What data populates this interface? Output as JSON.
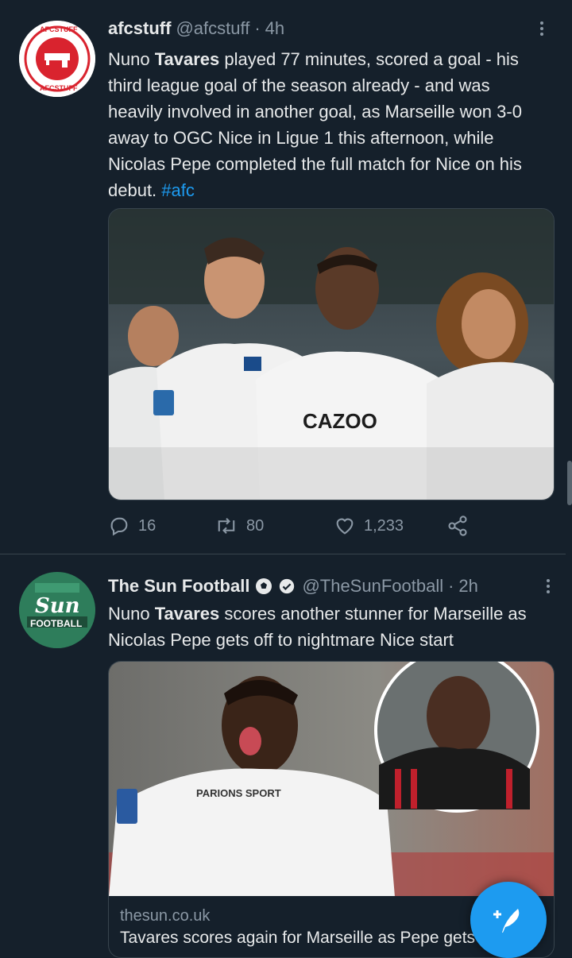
{
  "tweets": [
    {
      "name": "afcstuff",
      "handle": "@afcstuff",
      "separator": "·",
      "time": "4h",
      "avatar_text_top": "AFCSTUFF",
      "avatar_text_bottom": "AFCSTUFF",
      "text_parts": {
        "p1": "Nuno ",
        "bold": "Tavares",
        "p2": " played 77 minutes, scored a goal - his third league goal of the season already - and was heavily involved in another goal, as Marseille won 3-0 away to OGC Nice in Ligue 1 this afternoon, while Nicolas Pepe completed the full match for Nice on his debut. ",
        "hashtag": "#afc"
      },
      "image_shirt_text": "CAZOO",
      "actions": {
        "replies": "16",
        "retweets": "80",
        "likes": "1,233"
      }
    },
    {
      "name": "The Sun Football",
      "handle": "@TheSunFootball",
      "separator": "·",
      "time": "2h",
      "avatar_text_top": "Sun",
      "avatar_text_bottom": "FOOTBALL",
      "text_parts": {
        "p1": "Nuno ",
        "bold": "Tavares",
        "p2": " scores another stunner for Marseille as Nicolas Pepe gets off to nightmare Nice start"
      },
      "image_shirt_text": "PARIONS SPORT",
      "card": {
        "domain": "thesun.co.uk",
        "title": "Tavares scores again for Marseille as Pepe gets"
      }
    }
  ],
  "colors": {
    "background": "#15202b",
    "accent": "#1d9bf0",
    "secondary_text": "#8b98a5",
    "divider": "#38444d"
  },
  "icons": {
    "reply": "reply-icon",
    "retweet": "retweet-icon",
    "like": "heart-icon",
    "share": "share-icon",
    "more": "more-options-icon",
    "compose": "compose-tweet-icon"
  }
}
